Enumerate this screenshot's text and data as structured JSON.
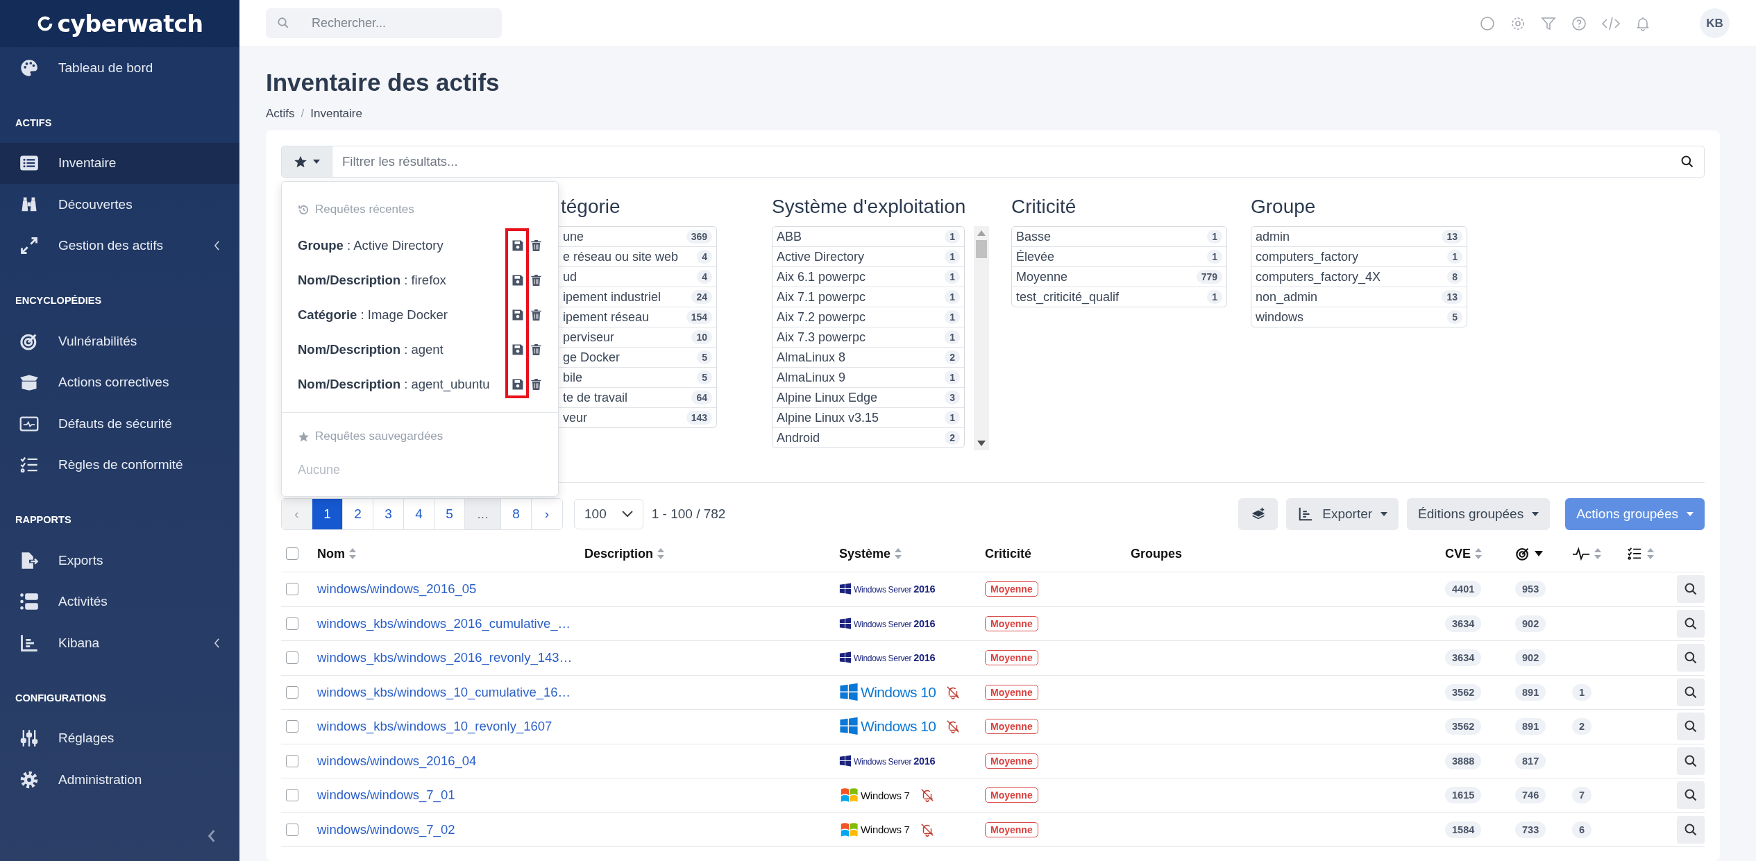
{
  "sidebar": {
    "logo": "cyberwatch",
    "sections": [
      {
        "items": [
          {
            "label": "Tableau de bord",
            "kind": "link",
            "selected": false
          }
        ]
      },
      {
        "title": "ACTIFS",
        "items": [
          {
            "label": "Inventaire",
            "kind": "link",
            "selected": true
          },
          {
            "label": "Découvertes",
            "kind": "link",
            "selected": false
          },
          {
            "label": "Gestion des actifs",
            "kind": "group",
            "selected": false
          }
        ]
      },
      {
        "title": "ENCYCLOPÉDIES",
        "items": [
          {
            "label": "Vulnérabilités",
            "kind": "link",
            "selected": false
          },
          {
            "label": "Actions correctives",
            "kind": "link",
            "selected": false
          },
          {
            "label": "Défauts de sécurité",
            "kind": "link",
            "selected": false
          },
          {
            "label": "Règles de conformité",
            "kind": "link",
            "selected": false
          }
        ]
      },
      {
        "title": "RAPPORTS",
        "items": [
          {
            "label": "Exports",
            "kind": "link",
            "selected": false
          },
          {
            "label": "Activités",
            "kind": "link",
            "selected": false
          },
          {
            "label": "Kibana",
            "kind": "group",
            "selected": false
          }
        ]
      },
      {
        "title": "CONFIGURATIONS",
        "items": [
          {
            "label": "Réglages",
            "kind": "link",
            "selected": false
          },
          {
            "label": "Administration",
            "kind": "link",
            "selected": false
          }
        ]
      }
    ]
  },
  "topbar": {
    "search": {
      "placeholder": "Rechercher..."
    },
    "avatar": "KB"
  },
  "page": {
    "title": "Inventaire des actifs",
    "breadcrumb": {
      "items": [
        "Actifs",
        "Inventaire"
      ],
      "separator": "/"
    }
  },
  "filter": {
    "placeholder": "Filtrer les résultats...",
    "facets": [
      {
        "title": "tégorie",
        "scrollable": false,
        "items": [
          {
            "label": "une",
            "count": "369"
          },
          {
            "label": "e réseau ou site web",
            "count": "4"
          },
          {
            "label": "ud",
            "count": "4"
          },
          {
            "label": "ipement industriel",
            "count": "24"
          },
          {
            "label": "ipement réseau",
            "count": "154"
          },
          {
            "label": "perviseur",
            "count": "10"
          },
          {
            "label": "ge Docker",
            "count": "5"
          },
          {
            "label": "bile",
            "count": "5"
          },
          {
            "label": "te de travail",
            "count": "64"
          },
          {
            "label": "veur",
            "count": "143"
          }
        ]
      },
      {
        "title": "Système d'exploitation",
        "scrollable": true,
        "items": [
          {
            "label": "ABB",
            "count": "1"
          },
          {
            "label": "Active Directory",
            "count": "1"
          },
          {
            "label": "Aix 6.1 powerpc",
            "count": "1"
          },
          {
            "label": "Aix 7.1 powerpc",
            "count": "1"
          },
          {
            "label": "Aix 7.2 powerpc",
            "count": "1"
          },
          {
            "label": "Aix 7.3 powerpc",
            "count": "1"
          },
          {
            "label": "AlmaLinux 8",
            "count": "2"
          },
          {
            "label": "AlmaLinux 9",
            "count": "1"
          },
          {
            "label": "Alpine Linux Edge",
            "count": "3"
          },
          {
            "label": "Alpine Linux v3.15",
            "count": "1"
          },
          {
            "label": "Android",
            "count": "2"
          }
        ]
      },
      {
        "title": "Criticité",
        "scrollable": false,
        "items": [
          {
            "label": "Basse",
            "count": "1"
          },
          {
            "label": "Élevée",
            "count": "1"
          },
          {
            "label": "Moyenne",
            "count": "779"
          },
          {
            "label": "test_criticité_qualif",
            "count": "1"
          }
        ]
      },
      {
        "title": "Groupe",
        "scrollable": false,
        "items": [
          {
            "label": "admin",
            "count": "13"
          },
          {
            "label": "computers_factory",
            "count": "1"
          },
          {
            "label": "computers_factory_4X",
            "count": "8"
          },
          {
            "label": "non_admin",
            "count": "13"
          },
          {
            "label": "windows",
            "count": "5"
          }
        ]
      }
    ]
  },
  "query_menu": {
    "recent_title": "Requêtes récentes",
    "recent": [
      {
        "query": "**Groupe** : Active Directory"
      },
      {
        "query": "**Nom/Description** : firefox"
      },
      {
        "query": "**Catégorie** : Image Docker"
      },
      {
        "query": "**Nom/Description** : agent"
      },
      {
        "query": "**Nom/Description** : agent_ubuntu"
      }
    ],
    "save_icons_highlighted": true,
    "saved_title": "Requêtes sauvegardées",
    "saved_empty": "Aucune"
  },
  "pagination": {
    "prev": {
      "label": "‹",
      "disabled": true
    },
    "pages": [
      {
        "label": "1",
        "kind": "page",
        "selected": true
      },
      {
        "label": "2",
        "kind": "page",
        "selected": false
      },
      {
        "label": "3",
        "kind": "page",
        "selected": false
      },
      {
        "label": "4",
        "kind": "page",
        "selected": false
      },
      {
        "label": "5",
        "kind": "page",
        "selected": false
      },
      {
        "label": "...",
        "kind": "gap",
        "selected": false
      },
      {
        "label": "8",
        "kind": "page",
        "selected": false
      }
    ],
    "next": {
      "label": "›",
      "disabled": false
    },
    "per_page": "100",
    "range": "1 - 100 / 782"
  },
  "toolbar": {
    "buttons": [
      {
        "label": "Exporter",
        "kind": "export"
      },
      {
        "label": "Éditions groupées",
        "kind": "plain"
      },
      {
        "label": "Actions groupées",
        "kind": "primary"
      }
    ]
  },
  "table": {
    "select_all_checked": false,
    "columns": [
      {
        "kind": "text",
        "label": "Nom",
        "sortable": true
      },
      {
        "kind": "text",
        "label": "Description",
        "sortable": true
      },
      {
        "kind": "text",
        "label": "Système",
        "sortable": true
      },
      {
        "kind": "text",
        "label": "Criticité",
        "sortable": false
      },
      {
        "kind": "text",
        "label": "Groupes",
        "sortable": false
      },
      {
        "kind": "text",
        "label": "CVE",
        "sortable": true
      },
      {
        "kind": "target",
        "sortable": true,
        "sorted_descending": true
      },
      {
        "kind": "pulse",
        "sortable": true,
        "sorted_descending": false
      },
      {
        "kind": "checklist",
        "sortable": true,
        "sorted_descending": false
      }
    ],
    "rows": [
      {
        "checked": false,
        "name": "windows/windows_2016_05",
        "os": {
          "kind": "winserver",
          "label": "Windows Server **2016**"
        },
        "alerts_muted": false,
        "criticality": "Moyenne",
        "cve": "4401",
        "score": "953"
      },
      {
        "checked": false,
        "name": "windows_kbs/windows_2016_cumulative_…",
        "os": {
          "kind": "winserver",
          "label": "Windows Server **2016**"
        },
        "alerts_muted": false,
        "criticality": "Moyenne",
        "cve": "3634",
        "score": "902"
      },
      {
        "checked": false,
        "name": "windows_kbs/windows_2016_revonly_143…",
        "os": {
          "kind": "winserver",
          "label": "Windows Server **2016**"
        },
        "alerts_muted": false,
        "criticality": "Moyenne",
        "cve": "3634",
        "score": "902"
      },
      {
        "checked": false,
        "name": "windows_kbs/windows_10_cumulative_16…",
        "os": {
          "kind": "win10",
          "label": "Windows 10"
        },
        "alerts_muted": true,
        "criticality": "Moyenne",
        "cve": "3562",
        "score": "891",
        "events": "1"
      },
      {
        "checked": false,
        "name": "windows_kbs/windows_10_revonly_1607",
        "os": {
          "kind": "win10",
          "label": "Windows 10"
        },
        "alerts_muted": true,
        "criticality": "Moyenne",
        "cve": "3562",
        "score": "891",
        "events": "2"
      },
      {
        "checked": false,
        "name": "windows/windows_2016_04",
        "os": {
          "kind": "winserver",
          "label": "Windows Server **2016**"
        },
        "alerts_muted": false,
        "criticality": "Moyenne",
        "cve": "3888",
        "score": "817"
      },
      {
        "checked": false,
        "name": "windows/windows_7_01",
        "os": {
          "kind": "win7",
          "label": "Windows 7"
        },
        "alerts_muted": true,
        "criticality": "Moyenne",
        "cve": "1615",
        "score": "746",
        "events": "7"
      },
      {
        "checked": false,
        "name": "windows/windows_7_02",
        "os": {
          "kind": "win7",
          "label": "Windows 7"
        },
        "alerts_muted": true,
        "criticality": "Moyenne",
        "cve": "1584",
        "score": "733",
        "events": "6"
      }
    ]
  }
}
